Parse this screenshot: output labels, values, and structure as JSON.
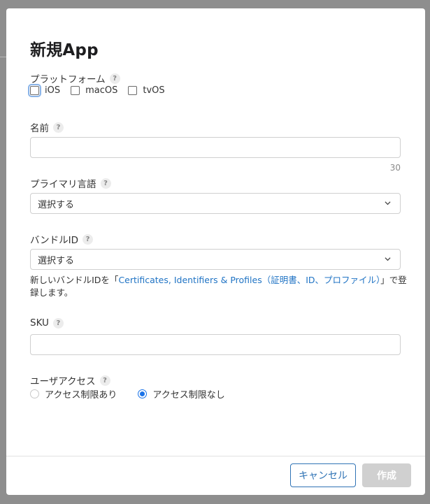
{
  "dialog": {
    "title": "新規App",
    "platform": {
      "label": "プラットフォーム",
      "options": [
        "iOS",
        "macOS",
        "tvOS"
      ]
    },
    "name": {
      "label": "名前",
      "value": "",
      "counter": "30"
    },
    "primary_language": {
      "label": "プライマリ言語",
      "value": "選択する"
    },
    "bundle_id": {
      "label": "バンドルID",
      "value": "選択する",
      "note_before": "新しいバンドルIDを「",
      "note_link": "Certificates, Identifiers & Profiles（証明書、ID、プロファイル）",
      "note_after": "」で登録します。"
    },
    "sku": {
      "label": "SKU",
      "value": ""
    },
    "user_access": {
      "label": "ユーザアクセス",
      "options": [
        "アクセス制限あり",
        "アクセス制限なし"
      ],
      "selected": "アクセス制限なし"
    },
    "buttons": {
      "cancel": "キャンセル",
      "create": "作成"
    },
    "help_glyph": "?"
  }
}
